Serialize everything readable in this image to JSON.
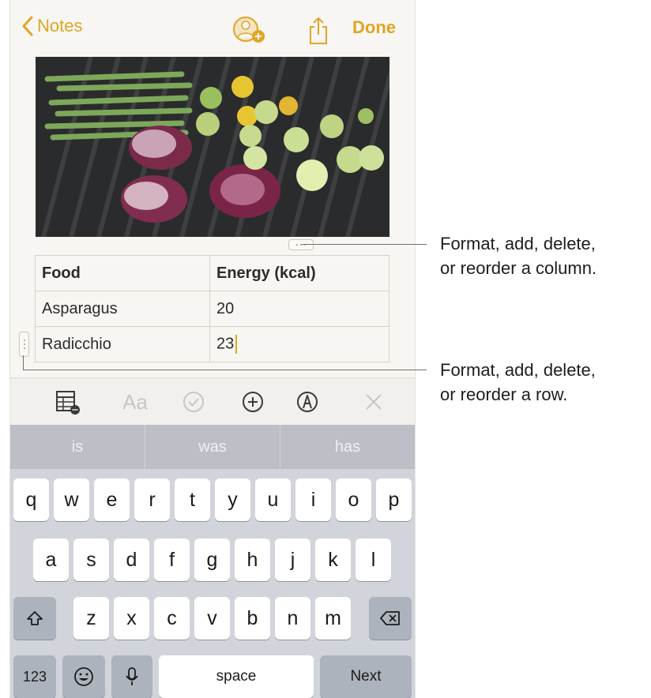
{
  "nav": {
    "back_label": "Notes",
    "done_label": "Done"
  },
  "table": {
    "rows": [
      [
        "Food",
        "Energy (kcal)"
      ],
      [
        "Asparagus",
        "20"
      ],
      [
        "Radicchio",
        "23"
      ]
    ]
  },
  "format_bar": {
    "text_style_label": "Aa"
  },
  "keyboard": {
    "suggestions": [
      "is",
      "was",
      "has"
    ],
    "row1": [
      "q",
      "w",
      "e",
      "r",
      "t",
      "y",
      "u",
      "i",
      "o",
      "p"
    ],
    "row2": [
      "a",
      "s",
      "d",
      "f",
      "g",
      "h",
      "j",
      "k",
      "l"
    ],
    "row3": [
      "z",
      "x",
      "c",
      "v",
      "b",
      "n",
      "m"
    ],
    "numbers_label": "123",
    "space_label": "space",
    "return_label": "Next"
  },
  "callouts": {
    "column": [
      "Format, add, delete,",
      "or reorder a column."
    ],
    "row": [
      "Format, add, delete,",
      "or reorder a row."
    ]
  },
  "colors": {
    "accent": "#e0a526",
    "paper": "#f7f6f2",
    "keyboard_bg": "#d1d4da"
  }
}
